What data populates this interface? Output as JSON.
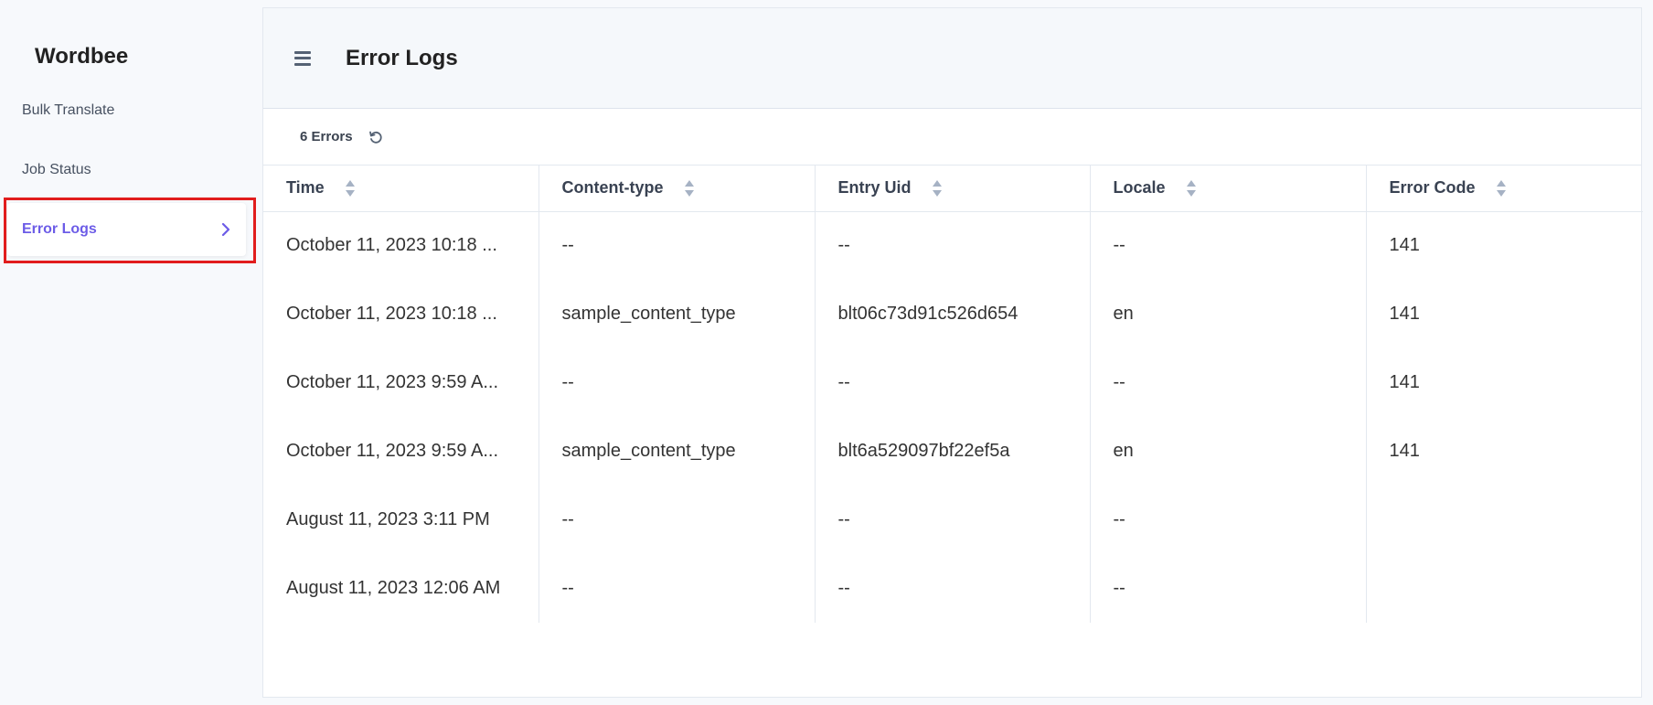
{
  "sidebar": {
    "brand": "Wordbee",
    "items": [
      {
        "label": "Bulk Translate",
        "active": false
      },
      {
        "label": "Job Status",
        "active": false
      },
      {
        "label": "Error Logs",
        "active": true
      }
    ]
  },
  "header": {
    "title": "Error Logs",
    "menu_icon": "hamburger-icon"
  },
  "toolbar": {
    "count_label": "6 Errors",
    "refresh_icon": "refresh-icon"
  },
  "table": {
    "columns": [
      "Time",
      "Content-type",
      "Entry Uid",
      "Locale",
      "Error Code"
    ],
    "rows": [
      [
        "October 11, 2023 10:18 ...",
        "--",
        "--",
        "--",
        "141"
      ],
      [
        "October 11, 2023 10:18 ...",
        "sample_content_type",
        "blt06c73d91c526d654",
        "en",
        "141"
      ],
      [
        "October 11, 2023 9:59 A...",
        "--",
        "--",
        "--",
        "141"
      ],
      [
        "October 11, 2023 9:59 A...",
        "sample_content_type",
        "blt6a529097bf22ef5a",
        "en",
        "141"
      ],
      [
        "August 11, 2023 3:11 PM",
        "--",
        "--",
        "--",
        ""
      ],
      [
        "August 11, 2023 12:06 AM",
        "--",
        "--",
        "--",
        ""
      ]
    ]
  },
  "colors": {
    "accent": "#6c5ce7",
    "highlight": "#e11d1d",
    "header_bg": "#f5f8fb"
  }
}
